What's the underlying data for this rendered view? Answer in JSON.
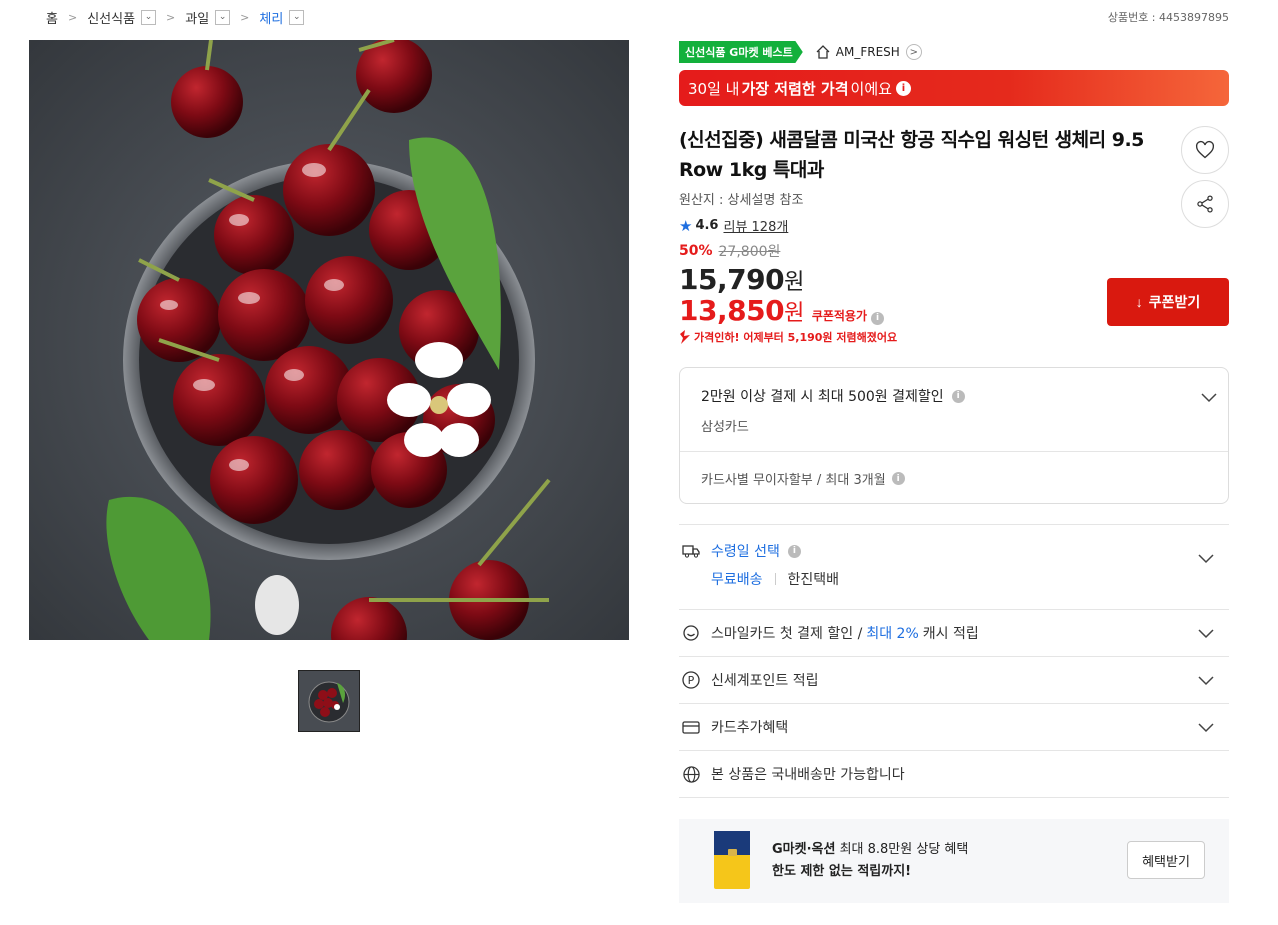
{
  "breadcrumb": [
    {
      "label": "홈"
    },
    {
      "label": "신선식품"
    },
    {
      "label": "과일"
    },
    {
      "label": "체리"
    }
  ],
  "product_no": "상품번호 : 4453897895",
  "badge": {
    "best": "신선식품 G마켓 베스트",
    "store": "AM_FRESH"
  },
  "low_price": {
    "prefix": "30일 내 ",
    "bold": "가장 저렴한 가격",
    "suffix": "이에요"
  },
  "title": "(신선집중) 새콤달콤 미국산 항공 직수입 워싱턴 생체리 9.5 Row 1kg 특대과",
  "origin": "원산지 : 상세설명 참조",
  "rating": {
    "score": "4.6",
    "reviews": "리뷰 128개"
  },
  "price": {
    "discount_rate": "50%",
    "original": "27,800원",
    "sale": "15,790",
    "coupon": "13,850",
    "won": "원",
    "coupon_label": "쿠폰적용가",
    "drop_notice": "가격인하! 어제부터 5,190원 저렴해졌어요",
    "coupon_button": "쿠폰받기"
  },
  "card_benefit": {
    "title": "2만원 이상 결제 시 최대 500원 결제할인",
    "card": "삼성카드",
    "installment": "카드사별 무이자할부 / 최대 3개월"
  },
  "delivery": {
    "title": "수령일 선택",
    "free": "무료배송",
    "courier": "한진택배"
  },
  "smile": {
    "prefix": "스마일카드 첫 결제 할인 / ",
    "highlight": "최대 2%",
    "suffix": " 캐시 적립"
  },
  "point": "신세계포인트 적립",
  "card_extra": "카드추가혜택",
  "domestic": "본 상품은 국내배송만 가능합니다",
  "promo": {
    "line1_bold": "G마켓·옥션",
    "line1_rest": " 최대 8.8만원 상당 혜택",
    "line2": "한도 제한 없는 적립까지!",
    "button": "혜택받기"
  },
  "colors": {
    "accent_red": "#e51b1b",
    "best_green": "#13b03c",
    "link_blue": "#1f6fe0"
  }
}
